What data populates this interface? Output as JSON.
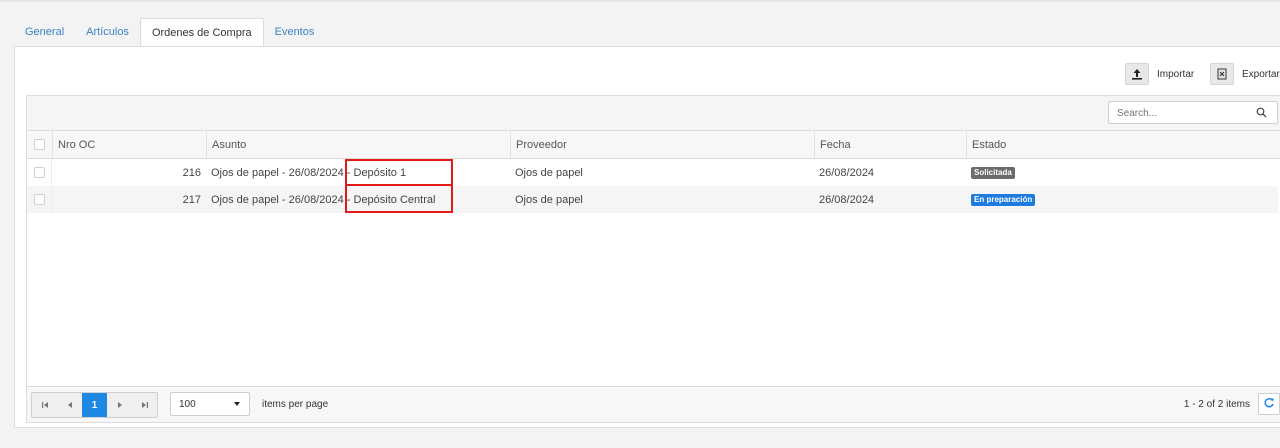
{
  "tabs": [
    {
      "label": "General"
    },
    {
      "label": "Artículos"
    },
    {
      "label": "Ordenes de Compra"
    },
    {
      "label": "Eventos"
    }
  ],
  "toolbar": {
    "import_label": "Importar",
    "export_label": "Exportar"
  },
  "search": {
    "placeholder": "Search..."
  },
  "table": {
    "columns": [
      "Nro OC",
      "Asunto",
      "Proveedor",
      "Fecha",
      "Estado"
    ],
    "rows": [
      {
        "nro": "216",
        "asunto_a": "Ojos de papel - 26/08/2024 -",
        "asunto_b": "Depósito 1",
        "proveedor": "Ojos de papel",
        "fecha": "26/08/2024",
        "estado": "Solicitada",
        "estado_color": "#6b6b6b"
      },
      {
        "nro": "217",
        "asunto_a": "Ojos de papel - 26/08/2024 -",
        "asunto_b": "Depósito Central",
        "proveedor": "Ojos de papel",
        "fecha": "26/08/2024",
        "estado": "En preparación",
        "estado_color": "#1e7be0"
      }
    ]
  },
  "pager": {
    "current_page": "1",
    "page_size": "100",
    "items_per_page_label": "items per page",
    "info": "1 - 2 of 2 items"
  },
  "colors": {
    "highlight": "#e01b1b",
    "accent": "#1e88e5"
  }
}
